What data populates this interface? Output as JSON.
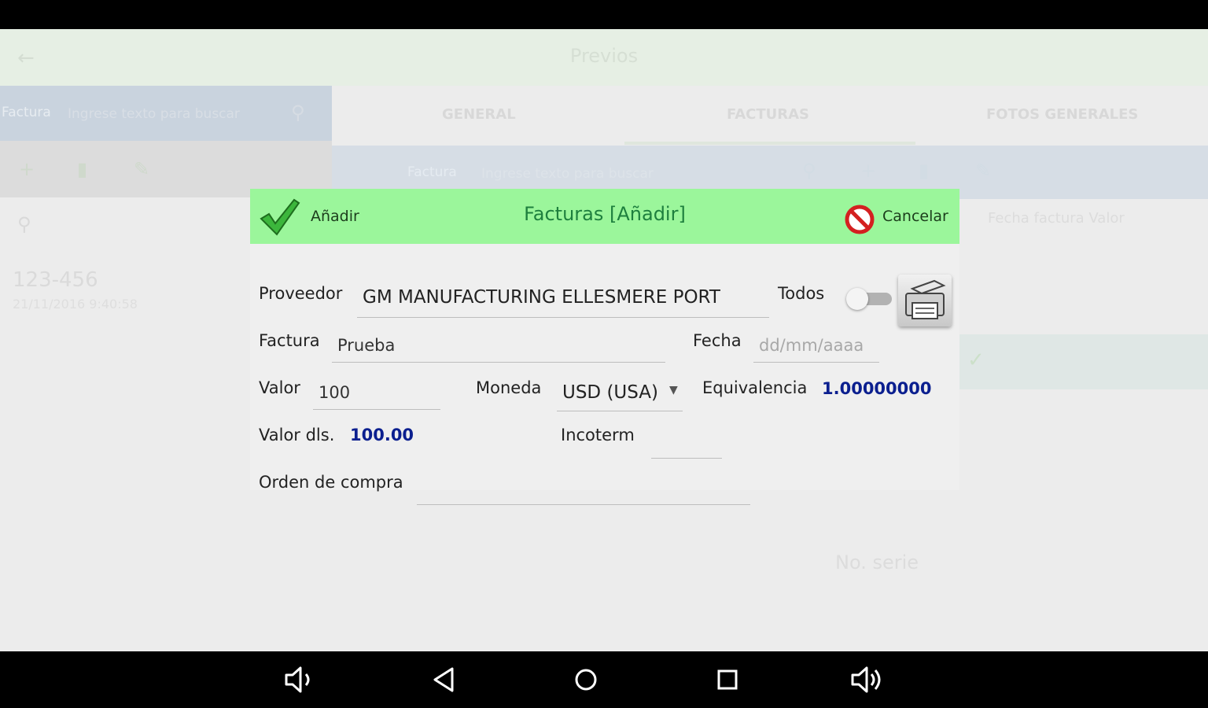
{
  "app": {
    "title": "Previos",
    "tabs": [
      "GENERAL",
      "FACTURAS",
      "FOTOS GENERALES"
    ],
    "left_search": {
      "label": "Factura",
      "placeholder": "Ingrese texto para buscar"
    },
    "right_search": {
      "label": "Factura",
      "placeholder": "Ingrese texto para buscar"
    },
    "left_list": [
      {
        "title": "123-456",
        "subtitle": "21/11/2016 9:40:58"
      }
    ],
    "column_headers": "Fecha factura   Valor",
    "no_serie": "No. serie"
  },
  "dialog": {
    "title": "Facturas [Añadir]",
    "add_label": "Añadir",
    "cancel_label": "Cancelar",
    "proveedor": {
      "label": "Proveedor",
      "value": "GM MANUFACTURING ELLESMERE PORT"
    },
    "todos": {
      "label": "Todos",
      "checked": false
    },
    "factura": {
      "label": "Factura",
      "value": "Prueba"
    },
    "fecha": {
      "label": "Fecha",
      "placeholder": "dd/mm/aaaa"
    },
    "valor": {
      "label": "Valor",
      "value": "100"
    },
    "moneda": {
      "label": "Moneda",
      "value": "USD (USA)"
    },
    "equivalencia": {
      "label": "Equivalencia",
      "value": "1.00000000"
    },
    "valor_dls": {
      "label": "Valor dls.",
      "value": "100.00"
    },
    "incoterm": {
      "label": "Incoterm",
      "value": ""
    },
    "orden_compra": {
      "label": "Orden de compra",
      "value": ""
    }
  },
  "colors": {
    "header_green": "#9bf69b",
    "title_green": "#1e7f3e",
    "value_blue": "#0b1f8f"
  },
  "icons": {
    "add": "checkmark-icon",
    "cancel": "no-entry-icon",
    "print": "printer-icon",
    "nav": [
      "volume-down-icon",
      "back-icon",
      "home-icon",
      "recents-icon",
      "volume-up-icon"
    ]
  }
}
